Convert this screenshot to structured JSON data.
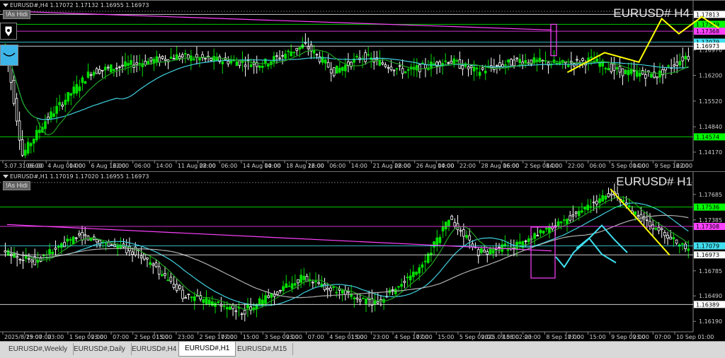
{
  "colors": {
    "bull": "#00e000",
    "bear": "#ffffff",
    "grid": "#2a2a2a",
    "ma_cyan": "#40d0e0",
    "ma_green": "#20a020",
    "ma_gray": "#b0b0b0",
    "trend": "#ff40ff",
    "drawing_yellow": "#ffff00",
    "projection": "#40e0f0",
    "hline_green": "#00c000"
  },
  "h4": {
    "header": "EURUSD#,H4  1.17072 1.17132 1.16955 1.16973",
    "as_hidden": "!As Hidi",
    "title": "EURUSD# H4",
    "price_labels": [
      {
        "text": "1.17813",
        "value": 1.17813,
        "bg": "#ffffff",
        "fg": "#000000"
      },
      {
        "text": "1.17549",
        "value": 1.17549,
        "bg": "#00ff00",
        "fg": "#000000"
      },
      {
        "text": "1.17368",
        "value": 1.17368,
        "bg": "#ff40ff",
        "fg": "#000000"
      },
      {
        "text": "1.17079",
        "value": 1.17079,
        "bg": "#40e0f0",
        "fg": "#000000"
      },
      {
        "text": "1.16973",
        "value": 1.16973,
        "bg": "#ffffff",
        "fg": "#000000"
      },
      {
        "text": "1.14574",
        "value": 1.14574,
        "bg": "#00ff00",
        "fg": "#000000"
      }
    ],
    "axis_labels": [
      "1.16970",
      "1.16200",
      "1.15520",
      "1.14840",
      "1.14170"
    ],
    "axis_values": [
      1.1687,
      1.162,
      1.1552,
      1.1484,
      1.1417
    ],
    "time_labels": [
      "5.07.31 06:00",
      "06:00",
      "4 Aug 00:00",
      "14:00",
      "6 Aug 16:00",
      "22:00",
      "06:00",
      "14:00",
      "11 Aug 08:00",
      "22:00",
      "06:00",
      "14 Aug 00:00",
      "14:00",
      "18 Aug 16:00",
      "22:00",
      "06:00",
      "14:00",
      "21 Aug 08:00",
      "22:00",
      "26 Aug 00:00",
      "14:00",
      "22:00",
      "28 Aug 16:00",
      "06:00",
      "2 Sep 08:00",
      "14:00",
      "22:00",
      "06:00",
      "5 Sep 00:00",
      "14:00",
      "9 Sep 16:00",
      "22:00"
    ]
  },
  "h1": {
    "header": "EURUSD#,H1  1.17019 1.17020 1.16955 1.16973",
    "as_hidden": "!As Hidi",
    "title": "EURUSD# H1",
    "price_labels": [
      {
        "text": "1.17536",
        "value": 1.17536,
        "bg": "#00ff00",
        "fg": "#000000"
      },
      {
        "text": "1.17308",
        "value": 1.17308,
        "bg": "#ff40ff",
        "fg": "#000000"
      },
      {
        "text": "1.17079",
        "value": 1.17079,
        "bg": "#40e0f0",
        "fg": "#000000"
      },
      {
        "text": "1.16973",
        "value": 1.16973,
        "bg": "#ffffff",
        "fg": "#000000"
      },
      {
        "text": "1.16389",
        "value": 1.16389,
        "bg": "#ffffff",
        "fg": "#000000"
      }
    ],
    "axis_labels": [
      "1.17685",
      "1.17385",
      "1.16785",
      "1.16490",
      "1.16190"
    ],
    "axis_values": [
      1.17685,
      1.17385,
      1.16785,
      1.1649,
      1.1619
    ],
    "time_labels": [
      "2025/8/29 07:00",
      "15:00",
      "23:00",
      "1 Sep 09:00",
      "23:00",
      "07:00",
      "2 Sep 01:00",
      "15:00",
      "23:00",
      "2 Sep 17:00",
      "07:00",
      "15:00",
      "3 Sep 09:00",
      "23:00",
      "07:00",
      "4 Sep 01:00",
      "15:00",
      "23:00",
      "4 Sep 17:00",
      "07:00",
      "15:00",
      "5 Sep 09:00",
      "2025.09.08 02:00",
      "15:00",
      "23:00",
      "8 Sep 17:00",
      "07:00",
      "15:00",
      "9 Sep 09:00",
      "23:00",
      "07:00",
      "10 Sep 01:00"
    ],
    "crosshair_time": "2025.09.08 08:00"
  },
  "tabs": [
    {
      "label": "EURUSD#,Weekly",
      "active": false
    },
    {
      "label": "EURUSD#,Daily",
      "active": false
    },
    {
      "label": "EURUSD#,H4",
      "active": false
    },
    {
      "label": "EURUSD#,H1",
      "active": true
    },
    {
      "label": "EURUSD#,M15",
      "active": false
    }
  ]
}
